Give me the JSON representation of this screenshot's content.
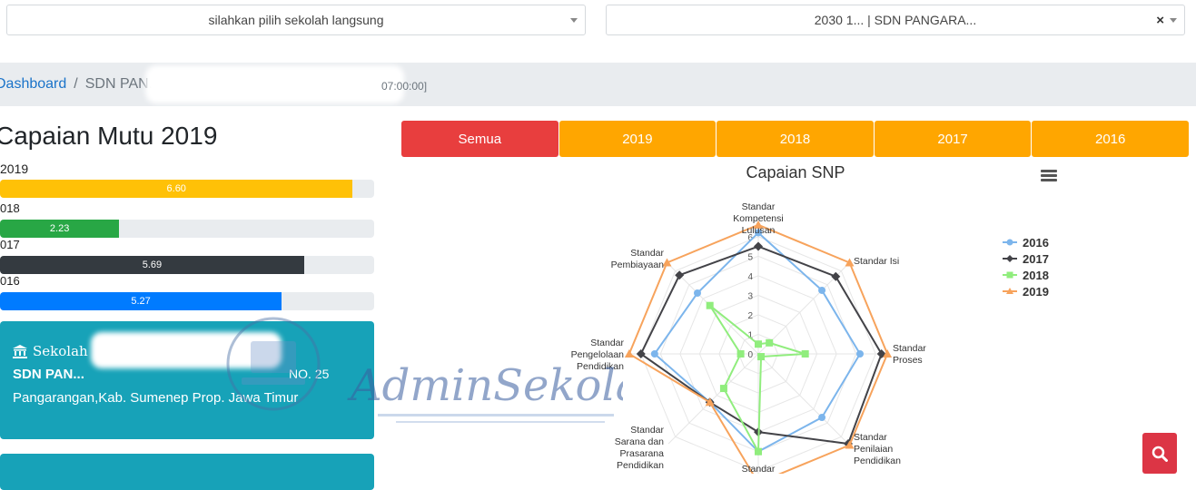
{
  "top_selects": {
    "school_placeholder": "silahkan pilih sekolah langsung",
    "selected_school": "2030 1... | SDN PANGARA..."
  },
  "breadcrumb": {
    "dashboard": "Dashboard",
    "separator": "/",
    "current": "SDN PAN...",
    "timestamp_fragment": "07:00:00]"
  },
  "page_title": "Capaian Mutu 2019",
  "progress_bars": [
    {
      "label": "2019",
      "value": 6.6,
      "display": "6.60",
      "color": "#ffc107"
    },
    {
      "label": "018",
      "value": 2.23,
      "display": "2.23",
      "color": "#28a745"
    },
    {
      "label": "017",
      "value": 5.69,
      "display": "5.69",
      "color": "#343a40"
    },
    {
      "label": "016",
      "value": 5.27,
      "display": "5.27",
      "color": "#007bff"
    }
  ],
  "progress_max": 7,
  "school_card": {
    "header": "Sekolah",
    "name": "SDN PAN...",
    "number": "NO. 25",
    "address": "Pangarangan,Kab. Sumenep Prop. Jawa Timur"
  },
  "tabs": [
    {
      "label": "Semua",
      "color": "#e83e3e"
    },
    {
      "label": "2019",
      "color": "#ffa600"
    },
    {
      "label": "2018",
      "color": "#ffa600"
    },
    {
      "label": "2017",
      "color": "#ffa600"
    },
    {
      "label": "2016",
      "color": "#ffa600"
    }
  ],
  "watermark_text": "AdminSekolah.Com",
  "chart_data": {
    "type": "radar",
    "title": "Capaian SNP",
    "categories": [
      "Standar Kompetensi Lulusan",
      "Standar Isi",
      "Standar Proses",
      "Standar Penilaian Pendidikan",
      "Standar ...",
      "Standar Sarana dan Prasarana Pendidikan",
      "Standar Pengelolaan Pendidikan",
      "Standar Pembiayaan"
    ],
    "radial_ticks": [
      "0",
      "1",
      "2",
      "3",
      "4",
      "5",
      "6"
    ],
    "rmax": 6.5,
    "series": [
      {
        "name": "2016",
        "color": "#7cb5ec",
        "marker": "circle",
        "values": [
          6.2,
          4.6,
          5.2,
          4.6,
          5.0,
          3.5,
          5.3,
          4.4
        ]
      },
      {
        "name": "2017",
        "color": "#434348",
        "marker": "diamond",
        "values": [
          5.5,
          5.6,
          6.3,
          6.5,
          4.0,
          3.5,
          6.0,
          5.7
        ]
      },
      {
        "name": "2018",
        "color": "#90ed7d",
        "marker": "square",
        "values": [
          0.5,
          0.8,
          2.4,
          0.2,
          5.0,
          2.5,
          0.9,
          3.5
        ]
      },
      {
        "name": "2019",
        "color": "#f7a35c",
        "marker": "triangle",
        "values": [
          6.6,
          6.6,
          6.6,
          6.6,
          6.6,
          3.5,
          6.6,
          6.6
        ]
      }
    ]
  }
}
